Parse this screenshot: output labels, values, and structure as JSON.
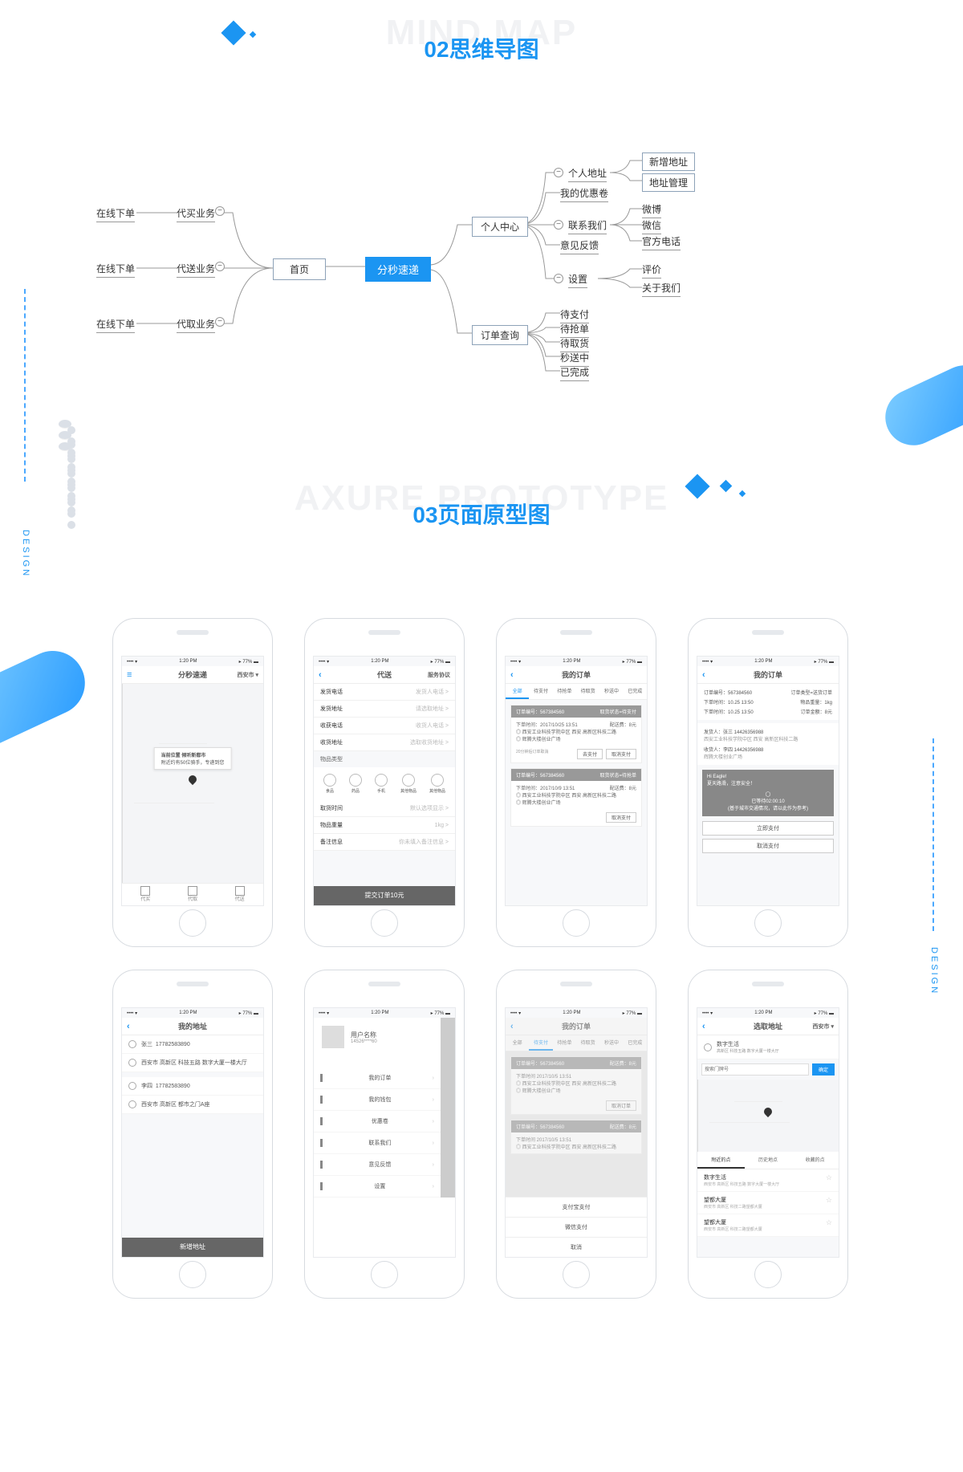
{
  "titles": {
    "section1": {
      "bg": "MIND MAP",
      "fg": "02思维导图"
    },
    "section2": {
      "bg": "AXURE PROTOTYPE",
      "fg": "03页面原型图"
    }
  },
  "rail": "DESIGN",
  "mindmap": {
    "center": "分秒速递",
    "home": "首页",
    "left": {
      "l1": [
        "代买业务",
        "代送业务",
        "代取业务"
      ],
      "l2": [
        "在线下单",
        "在线下单",
        "在线下单"
      ]
    },
    "right": {
      "personal": {
        "label": "个人中心",
        "children": {
          "addr": {
            "label": "个人地址",
            "children": [
              "新增地址",
              "地址管理"
            ]
          },
          "coupon": "我的优惠卷",
          "contact": {
            "label": "联系我们",
            "children": [
              "微博",
              "微信",
              "官方电话"
            ]
          },
          "feedback": "意见反馈",
          "settings": {
            "label": "设置",
            "children": [
              "评价",
              "关于我们"
            ]
          }
        }
      },
      "orders": {
        "label": "订单查询",
        "children": [
          "待支付",
          "待抢单",
          "待取货",
          "秒送中",
          "已完成"
        ]
      }
    }
  },
  "statusbar": {
    "left": "•••• ▾",
    "mid": "1:20 PM",
    "right": "▸ 77% ▬"
  },
  "screen1": {
    "title": "分秒速递",
    "city": "西安市 ▾",
    "popup_title": "当前位置 倾听新都市",
    "popup_sub": "附近约有50位骑手，专递到您",
    "tabs": [
      "代买",
      "代取",
      "代送"
    ]
  },
  "screen2": {
    "title": "代送",
    "right": "服务协议",
    "rows": [
      [
        "发货电话",
        "发货人电话 >"
      ],
      [
        "发货地址",
        "请选取地址 >"
      ],
      [
        "收获电话",
        "收货人电话 >"
      ],
      [
        "收货地址",
        "选取收货地址 >"
      ]
    ],
    "goods_label": "物品类型",
    "goods": [
      "食品",
      "药品",
      "手机",
      "其他物品",
      "其他物品"
    ],
    "rows2": [
      [
        "取货时间",
        "默认选项显示 >"
      ],
      [
        "物品重量",
        "1kg >"
      ],
      [
        "备注信息",
        "你未填入备注信息 >"
      ]
    ],
    "submit": "提交订单10元"
  },
  "screen3": {
    "title": "我的订单",
    "tabs": [
      "全部",
      "待支付",
      "待抢单",
      "待取货",
      "秒送中",
      "已完成"
    ],
    "order_no": "订单编号：567384560",
    "status1": "取货状态=待支付",
    "status2": "取货状态=待抢单",
    "time1": "下单时间：2017/10/25 13:51",
    "fee": "配送费：8元",
    "addr1": "西安工业科技学院中区 西安 高新区科技二路",
    "addr2": "辉腾大楼创业广场",
    "wait": "20分钟后订单取消",
    "btn_pay": "去支付",
    "btn_cancel": "取消支付",
    "time2": "下单时间：2017/10/9 13:51"
  },
  "screen4": {
    "title": "我的订单",
    "no": "订单编号：567384560",
    "type": "订单类型=送货订单",
    "t1": "下单时间：10.25 13:50",
    "w": "物品重量：1kg",
    "t2": "下单时间：10.25 13:50",
    "f": "订单金额：8元",
    "s": "发货人：张三  14426356988",
    "sa": "西安工业科技学院中区 西安 高新区科技二路",
    "r": "收货人：李四  14426356988",
    "ra": "辉腾大楼创业广场",
    "greet": "Hi Eagle!\n夏天路滑，注意安全！",
    "est": "已等待02:00:10\n(基于城市交通情况，请以此作为参考)",
    "pay": "立即支付",
    "cancel": "取消支付"
  },
  "screen5": {
    "title": "我的地址",
    "rows": [
      {
        "n": "张三",
        "p": "17782583890",
        "a": "西安市 高新区 科技五路 数字大厦一楼大厅"
      },
      {
        "n": "李四",
        "p": "17782583890",
        "a": "西安市 高新区 都市之门A座"
      }
    ],
    "add": "新增地址"
  },
  "screen6": {
    "name": "用户名称",
    "phone": "14526****60",
    "menu": [
      "我的订单",
      "我的钱包",
      "优惠卷",
      "联系我们",
      "意见反馈",
      "设置"
    ]
  },
  "screen7": {
    "title": "我的订单",
    "tabs": [
      "全部",
      "待支付",
      "待抢单",
      "待取货",
      "秒送中",
      "已完成"
    ],
    "no": "订单编号：567384560",
    "fee": "配送费：8元",
    "t": "下单时间 2017/10/5 13:51",
    "a1": "西安工业科技学院中区 西安 高新区科技二路",
    "a2": "辉腾大楼创业广场",
    "sheet": [
      "支付宝支付",
      "微信支付",
      "取消"
    ]
  },
  "screen8": {
    "title": "选取地址",
    "city": "西安市 ▾",
    "sel": "数字生活",
    "sel_sub": "高新区 科技五路 数字大厦一楼大厅",
    "placeholder": "搜索门牌号",
    "ok": "确定",
    "segtabs": [
      "附近的点",
      "历史地点",
      "收藏的点"
    ],
    "items": [
      {
        "t": "数字生活",
        "s": "西安市 高新区 科技五路 数字大厦一楼大厅"
      },
      {
        "t": "望都大厦",
        "s": "西安市 高新区 科技二路望都大厦"
      },
      {
        "t": "望都大厦",
        "s": "西安市 高新区 科技二路望都大厦"
      }
    ]
  }
}
